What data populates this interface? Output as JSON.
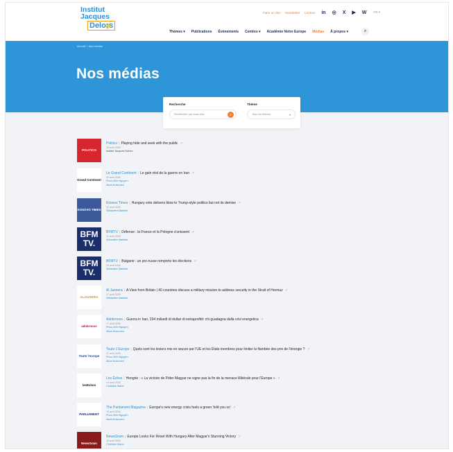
{
  "header": {
    "logo": {
      "line1": "Institut",
      "line2": "Jacques",
      "line3": "Delors"
    },
    "top_links": [
      "Faire un don",
      "Newsletter",
      "Contact"
    ],
    "social_icons": [
      "linkedin-icon",
      "instagram-icon",
      "x-icon",
      "youtube-icon",
      "bluesky-icon"
    ],
    "social_glyphs": [
      "in",
      "◎",
      "X",
      "▶",
      "W"
    ],
    "language": "FR ▾",
    "nav": [
      "Thèmes ▾",
      "Publications",
      "Évènements",
      "Centres ▾",
      "Académie Notre Europe",
      "Médias",
      "À propos ▾"
    ],
    "search_glyph": "⌕"
  },
  "hero": {
    "breadcrumb": "Accueil  >  Nos médias",
    "title": "Nos médias"
  },
  "filter": {
    "search_label": "Recherche",
    "search_placeholder": "Rechercher par mots-clés",
    "theme_label": "Thème",
    "theme_value": "Tous les thèmes"
  },
  "media": [
    {
      "source": "Politico",
      "title": "Playing hide and seek with the public",
      "date": "23 avril 2026",
      "authors": [
        "Institut Jacques Delors"
      ],
      "thumb": "POLITICO",
      "thumb_bg": "#d7262e",
      "thumb_fg": "#ffffff"
    },
    {
      "source": "Le Grand Continent",
      "title": "Le gain réel de la guerre en Iran",
      "date": "23 avril 2026",
      "authors": [
        "Phuc-Vinh Nguyen",
        "Aliza Moscovici"
      ],
      "thumb": "Grand Continent",
      "thumb_bg": "#ffffff",
      "thumb_fg": "#111111"
    },
    {
      "source": "Kosovo Times",
      "title": "Hungary vote delivers blow to Trump-style politics but not its demise",
      "date": "22 avril 2026",
      "authors": [
        "Sébastien Maillard"
      ],
      "thumb": "KOSOVO TIMES",
      "thumb_bg": "#3c5a9a",
      "thumb_fg": "#ffffff"
    },
    {
      "source": "BFMTV",
      "title": "Défense : la France et la Pologne s'unissent",
      "date": "21 avril 2026",
      "authors": [
        "Sébastien Maillard"
      ],
      "thumb": "BFM TV.",
      "thumb_bg": "#1a2e6b",
      "thumb_fg": "#ffffff"
    },
    {
      "source": "BFMTV",
      "title": "Bulgarie : un pro-russe remporte les élections",
      "date": "20 avril 2026",
      "authors": [
        "Sébastien Maillard"
      ],
      "thumb": "BFM TV.",
      "thumb_bg": "#1a2e6b",
      "thumb_fg": "#ffffff"
    },
    {
      "source": "Al Jazeera",
      "title": "A View from Britain | 40 countries discuss a military mission to address security in the Strait of Hormuz",
      "date": "17 avril 2026",
      "authors": [
        "Sébastien Maillard"
      ],
      "thumb": "ALJAZEERA",
      "thumb_bg": "#ffffff",
      "thumb_fg": "#d49a1a"
    },
    {
      "source": "Adnkronos",
      "title": "Guerra in Iran, 234 miliardi di dollari di extraprofitti: chi guadagna dalla crisi energetica",
      "date": "17 avril 2026",
      "authors": [
        "Phuc-Vinh Nguyen",
        "Aliza Moscovici"
      ],
      "thumb": "adnkronos",
      "thumb_bg": "#ffffff",
      "thumb_fg": "#c8102e"
    },
    {
      "source": "Toute L'Europe",
      "title": "Quels sont les leviers mis en œuvre par l'UE et les États membres pour limiter la flambée des prix de l'énergie ?",
      "date": "17 avril 2026",
      "authors": [
        "Phuc-Vinh Nguyen",
        "Aliza Moscovici"
      ],
      "thumb": "Toute l'europe",
      "thumb_bg": "#ffffff",
      "thumb_fg": "#1f3f8f"
    },
    {
      "source": "Les Échos",
      "title": "Hongrie : « La victoire de Péter Magyar ne signe pas la fin de la menace illibérale pour l'Europe »",
      "date": "15 avril 2026",
      "authors": [
        "Clothilde Warin"
      ],
      "thumb": "lesEchos",
      "thumb_bg": "#ffffff",
      "thumb_fg": "#111111"
    },
    {
      "source": "The Parliament Magazine",
      "title": "Europe's new energy crisis fuels a green 'told you so'",
      "date": "15 avril 2026",
      "authors": [
        "Phuc-Vinh Nguyen",
        "Aliza Moscovici"
      ],
      "thumb": "PARLIAMENT",
      "thumb_bg": "#ffffff",
      "thumb_fg": "#1a2e6b"
    },
    {
      "source": "NewsGram",
      "title": "Europe Looks For Reset With Hungary After Magyar's Stunning Victory",
      "date": "15 avril 2026",
      "authors": [
        "Clothilde Warin"
      ],
      "thumb": "NewsGram",
      "thumb_bg": "#8b1a1a",
      "thumb_fg": "#ffffff"
    }
  ],
  "external_glyph": "↗"
}
